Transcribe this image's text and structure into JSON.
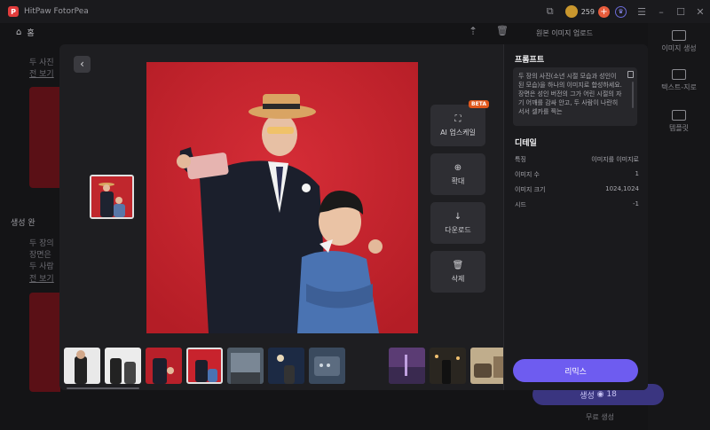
{
  "app": {
    "title": "HitPaw FotorPea",
    "credits": "259"
  },
  "home": {
    "label": "홈"
  },
  "background": {
    "left_texts": [
      "두 사진",
      "전 보기",
      "생성 완",
      "두 장의",
      "장면은",
      "두 사람",
      "전 보기"
    ],
    "right_items": [
      {
        "label": "이미지 생성"
      },
      {
        "label": "텍스트-지로"
      },
      {
        "label": "템플릿"
      }
    ],
    "upload_title": "원본 이미지 업로드",
    "generate_label": "생성",
    "generate_cost": "18",
    "hint": "무료 생성"
  },
  "modal": {
    "back_icon": "chevron-left-icon",
    "actions": [
      {
        "label": "AI 업스케일",
        "icon": "upscale-icon",
        "badge": "BETA"
      },
      {
        "label": "확대",
        "icon": "zoom-in-icon"
      },
      {
        "label": "다운로드",
        "icon": "download-icon"
      },
      {
        "label": "삭제",
        "icon": "trash-icon"
      }
    ],
    "panel": {
      "prompt_title": "프롬프트",
      "prompt_text": "두 장의 사진(소년 시절 모습과 성인이 된 모습)을 하나의 이미지로 합성하세요. 장면은 성인 버전의 그가 어린 시절의 자기 어깨를 감싸 안고, 두 사람이 나란히 서서 셀카를 찍는",
      "details_title": "디테일",
      "details": [
        {
          "label": "특징",
          "value": "이미지를 이미지로"
        },
        {
          "label": "이미지 수",
          "value": "1"
        },
        {
          "label": "이미지 크기",
          "value": "1024,1024"
        },
        {
          "label": "시드",
          "value": "-1"
        }
      ],
      "remix_label": "리믹스"
    }
  }
}
